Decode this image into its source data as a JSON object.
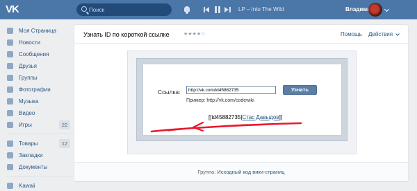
{
  "topbar": {
    "logo_text": "VK",
    "search_placeholder": "Поиск",
    "player": {
      "track": "LP – Into The Wild"
    },
    "user": {
      "name": "Владимир"
    }
  },
  "sidebar": {
    "items": [
      {
        "label": "Моя Страница",
        "icon": "home-icon"
      },
      {
        "label": "Новости",
        "icon": "news-icon"
      },
      {
        "label": "Сообщения",
        "icon": "messages-icon"
      },
      {
        "label": "Друзья",
        "icon": "friends-icon"
      },
      {
        "label": "Группы",
        "icon": "groups-icon"
      },
      {
        "label": "Фотографии",
        "icon": "camera-icon"
      },
      {
        "label": "Музыка",
        "icon": "music-icon"
      },
      {
        "label": "Видео",
        "icon": "video-icon"
      },
      {
        "label": "Игры",
        "icon": "games-icon",
        "count": "22"
      }
    ],
    "items2": [
      {
        "label": "Товары",
        "icon": "goods-icon",
        "count": "12"
      },
      {
        "label": "Закладки",
        "icon": "bookmark-icon"
      },
      {
        "label": "Документы",
        "icon": "document-icon"
      }
    ],
    "items3": [
      {
        "label": "Kawaii",
        "icon": "app-icon"
      }
    ]
  },
  "page": {
    "title": "Узнать ID по короткой ссылке",
    "stars": "★★★★☆",
    "help_label": "Помощь",
    "actions_label": "Действия",
    "form": {
      "field_label": "Ссылка:",
      "url_value": "http://vk.com/id45882735",
      "submit_label": "Узнать",
      "example_text": "Пример: http://vk.com/codewiki",
      "result_prefix": "[[id45882735|",
      "result_name": "Стас Давыдов",
      "result_suffix": "]]"
    },
    "footer": {
      "prefix": "Группа: ",
      "group_link": "Исходный код вики-страниц"
    }
  },
  "colors": {
    "header": "#4a76a8",
    "link": "#2a5885",
    "button": "#5b7ea6",
    "annotation_arrow": "#e8192c"
  }
}
